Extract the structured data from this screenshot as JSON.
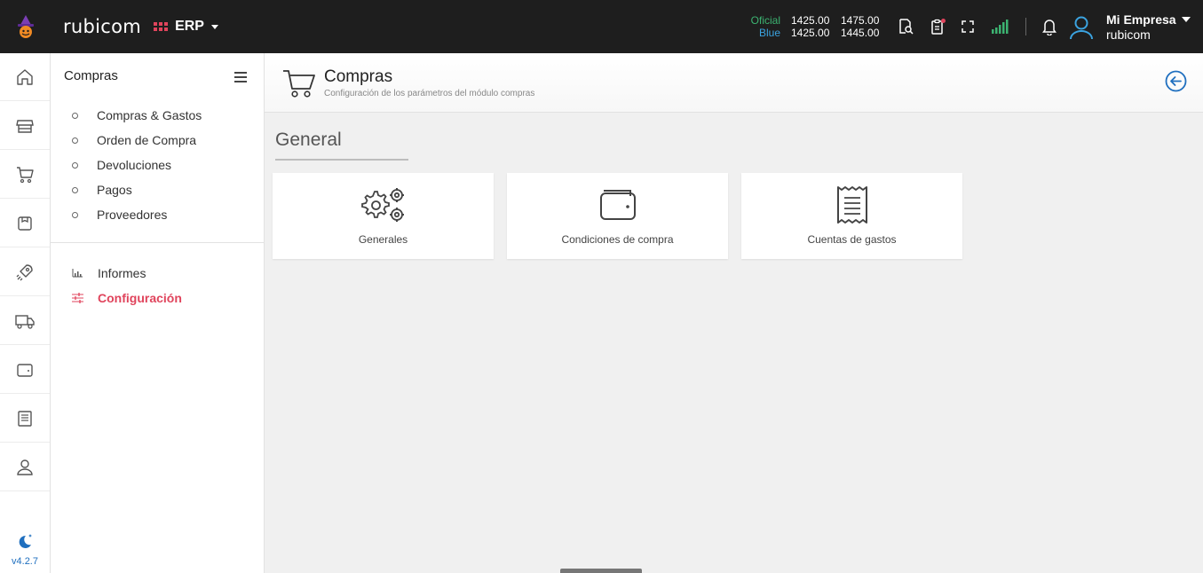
{
  "topbar": {
    "brand": "rubicom",
    "module": "ERP",
    "rates": {
      "oficial_label": "Oficial",
      "blue_label": "Blue",
      "oficial_buy": "1425.00",
      "oficial_sell": "1475.00",
      "blue_buy": "1425.00",
      "blue_sell": "1445.00"
    },
    "company_name": "Mi Empresa",
    "company_sub": "rubicom"
  },
  "rail": {
    "items": [
      "home-icon",
      "store-icon",
      "cart-icon",
      "box-icon",
      "rocket-icon",
      "truck-icon",
      "wallet-icon",
      "book-icon",
      "user-icon"
    ],
    "version": "v4.2.7"
  },
  "sidebar": {
    "title": "Compras",
    "items": [
      {
        "label": "Compras & Gastos"
      },
      {
        "label": "Orden de Compra"
      },
      {
        "label": "Devoluciones"
      },
      {
        "label": "Pagos"
      },
      {
        "label": "Proveedores"
      }
    ],
    "secondary": [
      {
        "label": "Informes",
        "icon": "chart-icon"
      },
      {
        "label": "Configuración",
        "icon": "sliders-icon"
      }
    ]
  },
  "header": {
    "title": "Compras",
    "subtitle": "Configuración de los parámetros del módulo compras"
  },
  "main": {
    "section": "General",
    "cards": [
      {
        "label": "Generales",
        "icon": "gears-icon"
      },
      {
        "label": "Condiciones de compra",
        "icon": "wallet-icon"
      },
      {
        "label": "Cuentas de gastos",
        "icon": "receipt-icon"
      }
    ]
  },
  "colors": {
    "accent": "#e0445c",
    "topbar": "#1e1e1e",
    "oficial": "#3cb371",
    "blue": "#3ba3e0"
  }
}
